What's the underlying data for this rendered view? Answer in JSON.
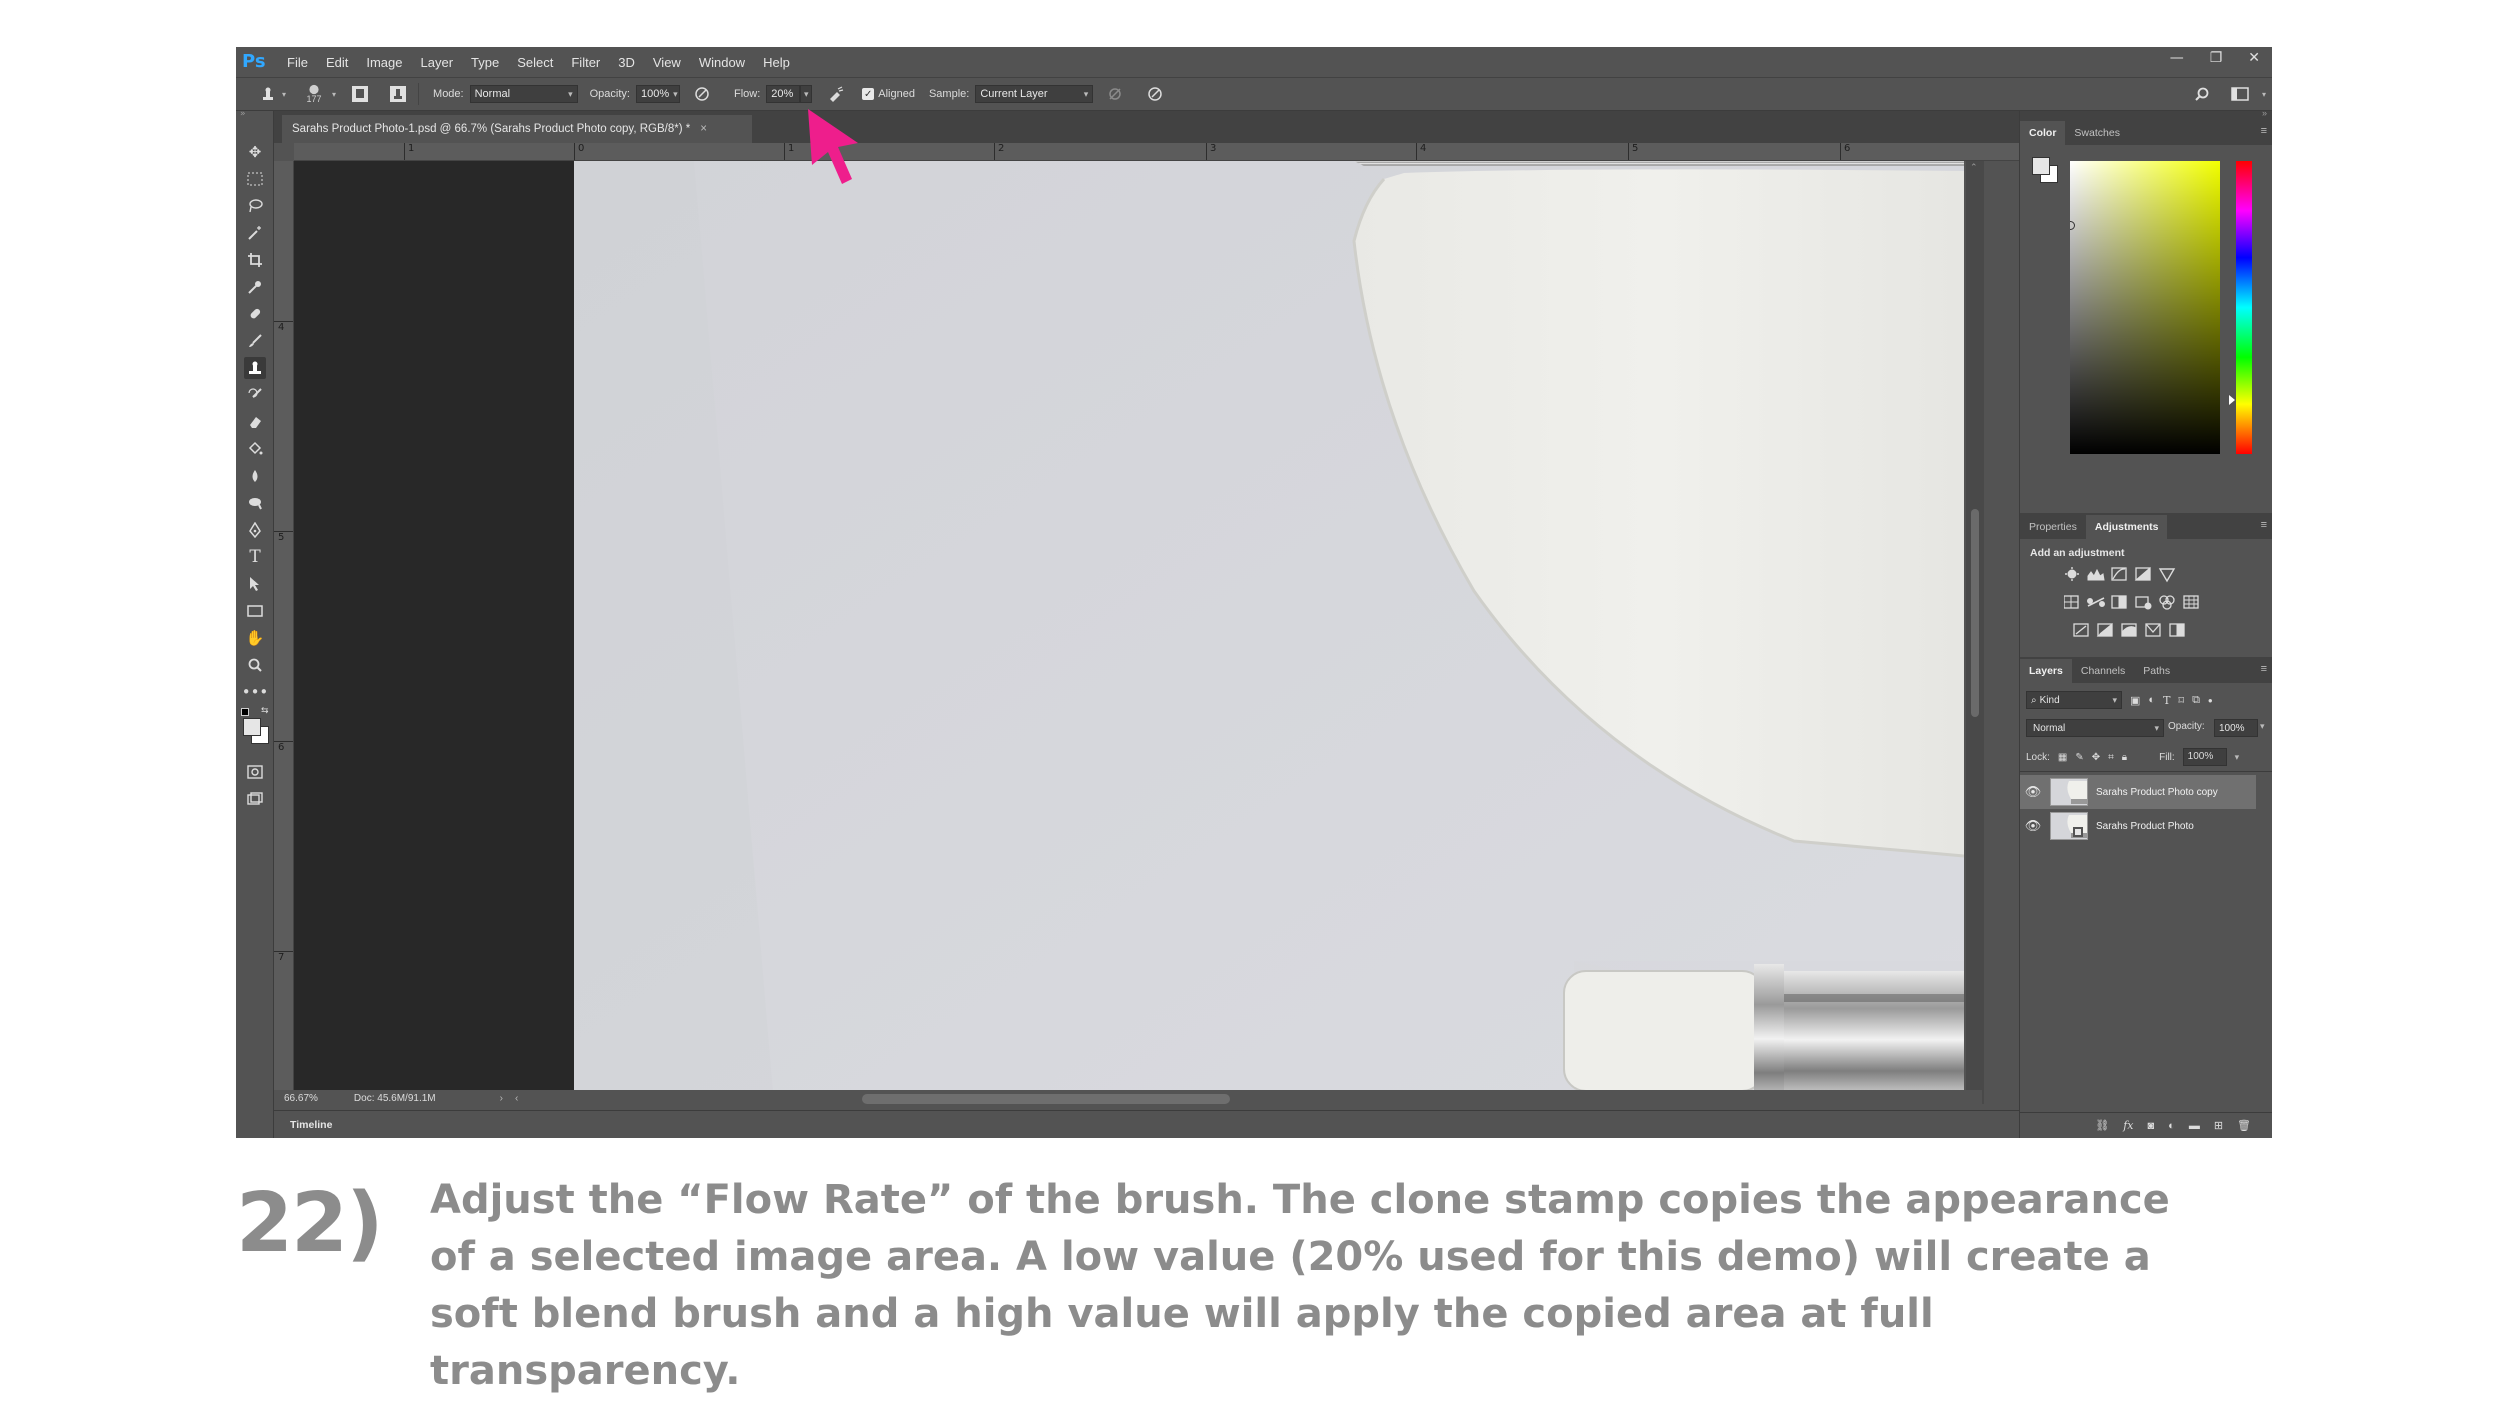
{
  "app": {
    "logo": "Ps",
    "menu": [
      "File",
      "Edit",
      "Image",
      "Layer",
      "Type",
      "Select",
      "Filter",
      "3D",
      "View",
      "Window",
      "Help"
    ],
    "window_controls": {
      "minimize": "—",
      "restore": "❐",
      "close": "✕"
    }
  },
  "options_bar": {
    "brush_size": "177",
    "mode_label": "Mode:",
    "mode_value": "Normal",
    "opacity_label": "Opacity:",
    "opacity_value": "100%",
    "flow_label": "Flow:",
    "flow_value": "20%",
    "aligned_label": "Aligned",
    "aligned_checked": true,
    "sample_label": "Sample:",
    "sample_value": "Current Layer",
    "flow_slider_level": 0.2
  },
  "document": {
    "tab_title": "Sarahs Product Photo-1.psd @ 66.7% (Sarahs Product Photo copy, RGB/8*) *",
    "tab_close": "×",
    "ruler_top": [
      "1",
      "0",
      "1",
      "2",
      "3",
      "4",
      "5",
      "6"
    ],
    "ruler_left": [
      "4",
      "5",
      "6",
      "7"
    ]
  },
  "status": {
    "zoom": "66.67%",
    "doc_info": "Doc: 45.6M/91.1M"
  },
  "timeline": {
    "label": "Timeline"
  },
  "color_panel": {
    "tabs": [
      "Color",
      "Swatches"
    ],
    "active_tab": "Color",
    "foreground": "#e6e6e6",
    "background": "#ffffff",
    "hue_color": "#f2ff00"
  },
  "adjustments_panel": {
    "tabs": [
      "Properties",
      "Adjustments"
    ],
    "active_tab": "Adjustments",
    "heading": "Add an adjustment"
  },
  "layers_panel": {
    "tabs": [
      "Layers",
      "Channels",
      "Paths"
    ],
    "active_tab": "Layers",
    "filter_kind": "Kind",
    "blend_mode": "Normal",
    "opacity_label": "Opacity:",
    "opacity_value": "100%",
    "lock_label": "Lock:",
    "fill_label": "Fill:",
    "fill_value": "100%",
    "layers": [
      {
        "name": "Sarahs Product Photo copy",
        "visible": true,
        "selected": true
      },
      {
        "name": "Sarahs Product Photo",
        "visible": true,
        "selected": false
      }
    ]
  },
  "annotation": {
    "arrow_color": "#ee1e8c"
  },
  "caption": {
    "step": "22)",
    "text": "Adjust the “Flow Rate” of the brush. The clone stamp copies the appearance of a selected image area. A low value (20% used for this demo) will create a soft blend brush and a high value will apply the copied area at full transparency."
  }
}
